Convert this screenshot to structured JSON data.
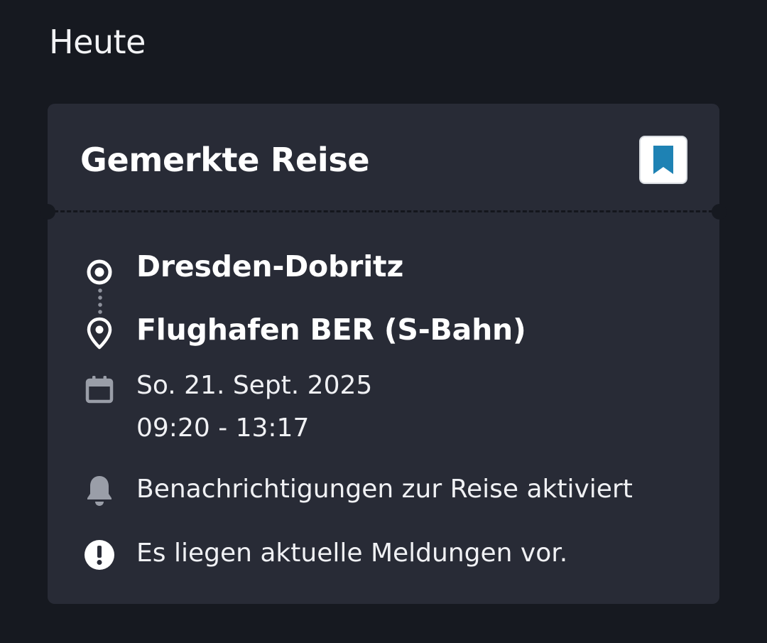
{
  "section": {
    "title": "Heute"
  },
  "card": {
    "title": "Gemerkte Reise",
    "bookmark_icon": "bookmark-icon",
    "origin": "Dresden-Dobritz",
    "destination": "Flughafen BER (S-Bahn)",
    "date": "So. 21. Sept. 2025",
    "time": "09:20 - 13:17",
    "notification_text": "Benachrichtigungen zur Reise aktiviert",
    "alert_text": "Es liegen aktuelle Meldungen vor."
  },
  "colors": {
    "background": "#161920",
    "card": "#282b36",
    "accent": "#1e82b4",
    "icon_gray": "#9a9ea8"
  }
}
